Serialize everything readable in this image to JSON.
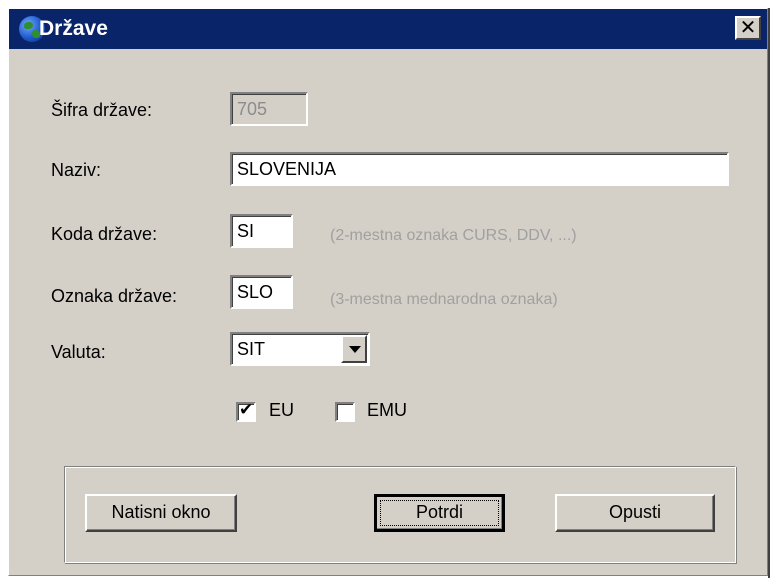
{
  "window": {
    "title": "Države",
    "close_label": "✕"
  },
  "form": {
    "sifra_label": "Šifra države:",
    "sifra_value": "705",
    "naziv_label": "Naziv:",
    "naziv_value": "SLOVENIJA",
    "koda_label": "Koda države:",
    "koda_value": "SI",
    "koda_hint": "(2-mestna oznaka CURS, DDV, ...)",
    "oznaka_label": "Oznaka države:",
    "oznaka_value": "SLO",
    "oznaka_hint": "(3-mestna mednarodna oznaka)",
    "valuta_label": "Valuta:",
    "valuta_value": "SIT"
  },
  "checkboxes": {
    "eu_label": "EU",
    "eu_checked": true,
    "emu_label": "EMU",
    "emu_checked": false,
    "check_glyph": "✔"
  },
  "buttons": {
    "print_label": "Natisni okno",
    "confirm_label": "Potrdi",
    "cancel_label": "Opusti"
  },
  "colors": {
    "titlebar": "#0a246a",
    "face": "#d4d0c8"
  }
}
